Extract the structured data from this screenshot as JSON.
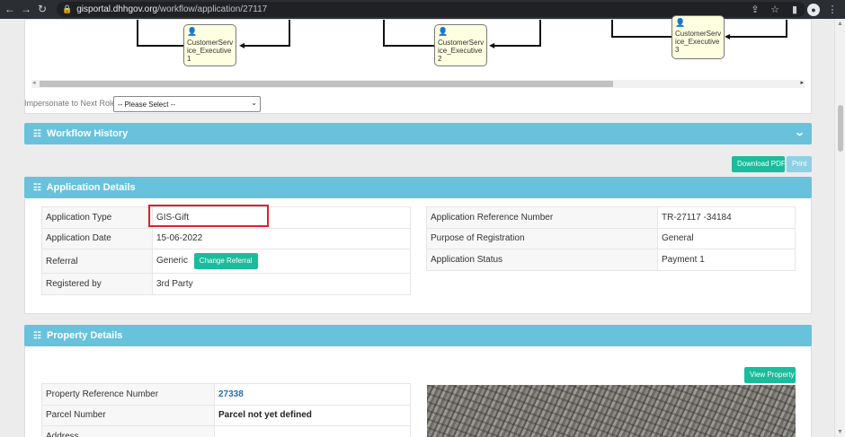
{
  "browser": {
    "url_host": "gisportal.dhhgov.org",
    "url_path": "/workflow/application/27117"
  },
  "workflow": {
    "nodes": [
      "CustomerService_Executive 1",
      "CustomerService_Executive 2",
      "CustomerService_Executive 3"
    ],
    "impersonate_label": "Impersonate to Next Role",
    "impersonate_selected": "-- Please Select --"
  },
  "workflow_history": {
    "title": "Workflow History"
  },
  "actions": {
    "download_pdf": "Download PDF",
    "print": "Print"
  },
  "application_details": {
    "title": "Application Details",
    "left_rows": [
      {
        "label": "Application Type",
        "value": "GIS-Gift"
      },
      {
        "label": "Application Date",
        "value": "15-06-2022"
      },
      {
        "label": "Referral",
        "value": "Generic"
      },
      {
        "label": "Registered by",
        "value": "3rd Party"
      }
    ],
    "change_referral": "Change Referral",
    "right_rows": [
      {
        "label": "Application Reference Number",
        "value": "TR-27117 -34184"
      },
      {
        "label": "Purpose of Registration",
        "value": "General"
      },
      {
        "label": "Application Status",
        "value": "Payment 1"
      }
    ]
  },
  "property_details": {
    "title": "Property Details",
    "view_property": "View Property",
    "rows": [
      {
        "label": "Property Reference Number",
        "value": "27338"
      },
      {
        "label": "Parcel Number",
        "value": "Parcel not yet defined"
      },
      {
        "label": "Address",
        "value": ""
      }
    ]
  },
  "colors": {
    "panel_header": "#68c2dc",
    "button_green": "#1bbc9b",
    "highlight_box": "#e0202a",
    "link": "#2b6cb0"
  }
}
